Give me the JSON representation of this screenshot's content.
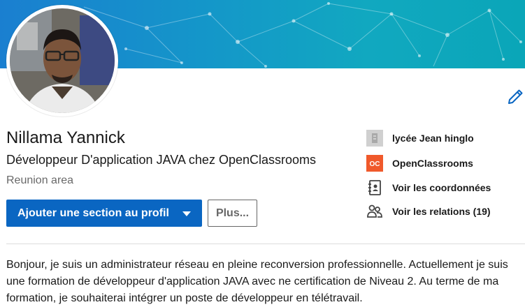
{
  "profile": {
    "name": "Nillama Yannick",
    "headline": "Développeur D'application JAVA chez OpenClassrooms",
    "location": "Reunion area"
  },
  "actions": {
    "add_section_label": "Ajouter une section au profil",
    "more_label": "Plus..."
  },
  "sidebar": {
    "school": "lycée Jean hinglo",
    "company": "OpenClassrooms",
    "company_logo_text": "OC",
    "contact": "Voir les coordonnées",
    "connections": "Voir les relations (19)"
  },
  "about": {
    "text": "Bonjour, je suis un administrateur réseau en pleine reconversion professionnelle. Actuellement je suis une formation de développeur d'application JAVA avec ne certification de Niveau 2. Au terme de ma formation, je souhaiterai intégrer un poste de développeur en télétravail."
  },
  "colors": {
    "primary_button": "#0a66c2",
    "company_logo": "#f0592b",
    "edit_icon": "#0a66c2"
  },
  "icons": [
    "pencil-icon",
    "school-icon",
    "company-logo-icon",
    "contact-card-icon",
    "people-icon",
    "caret-down-icon"
  ]
}
